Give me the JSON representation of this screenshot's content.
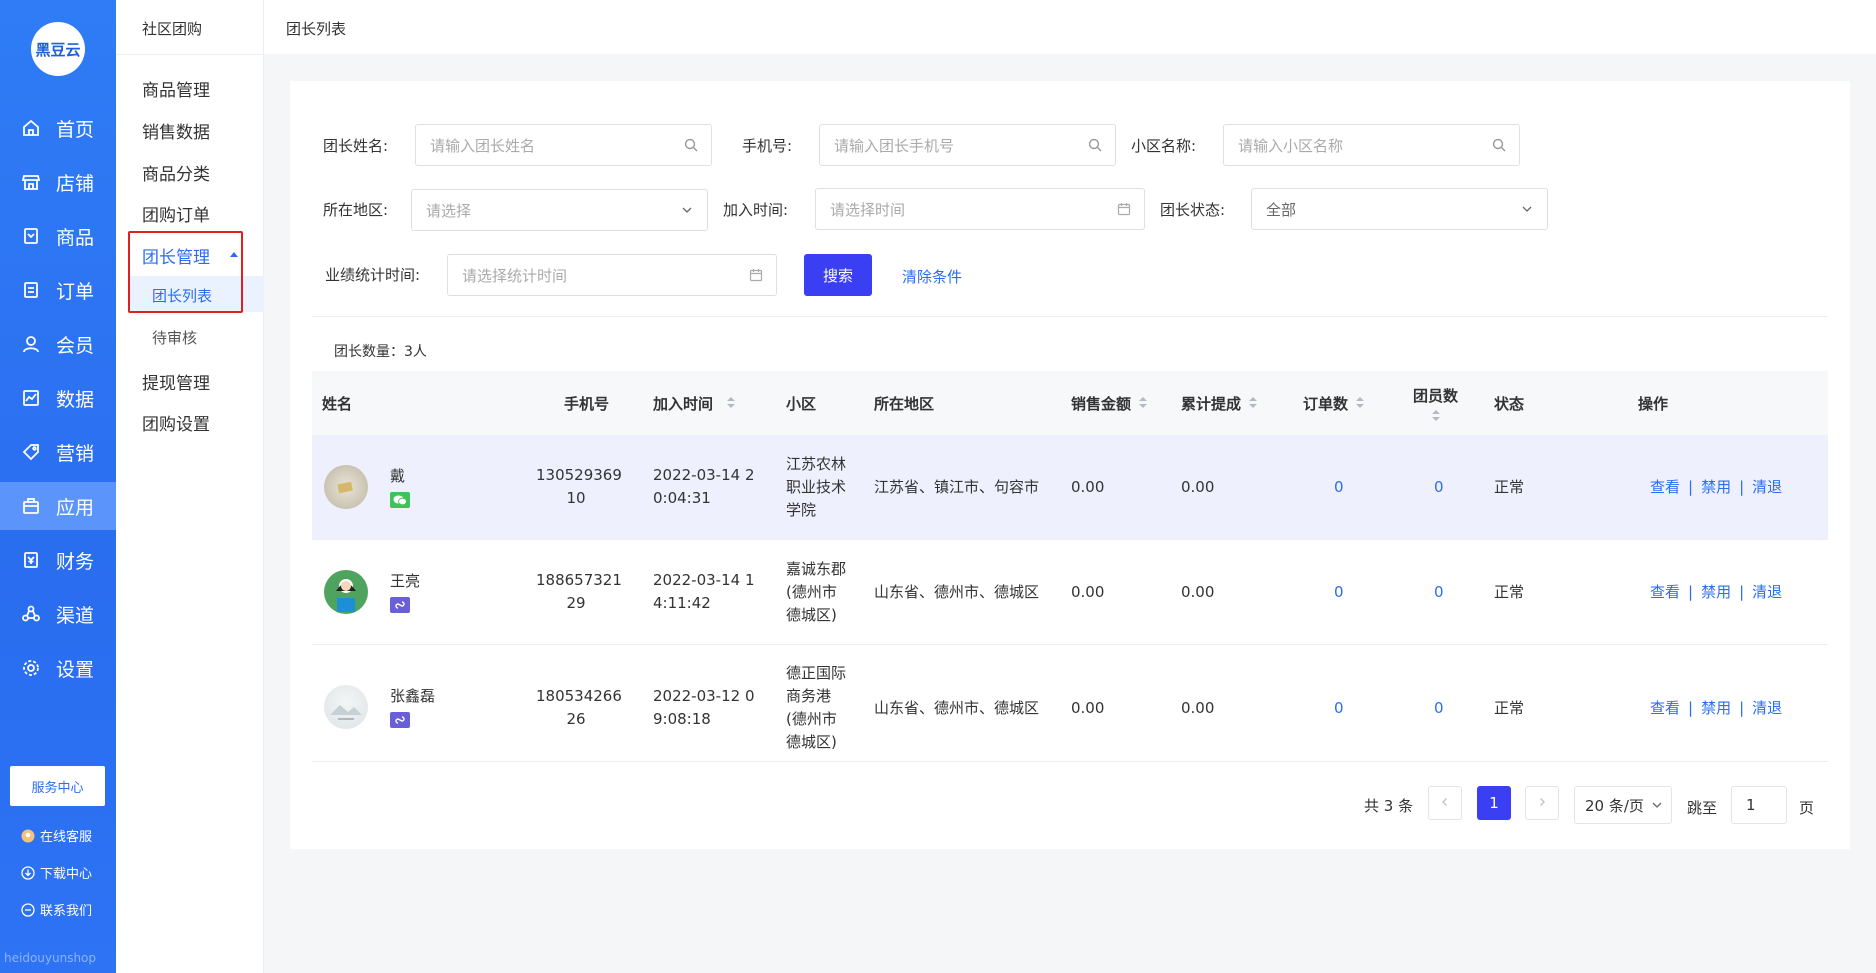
{
  "sidebar": {
    "logo_text": "黑豆云",
    "items": [
      {
        "label": "首页",
        "icon": "home-icon"
      },
      {
        "label": "店铺",
        "icon": "store-icon"
      },
      {
        "label": "商品",
        "icon": "product-icon"
      },
      {
        "label": "订单",
        "icon": "order-icon"
      },
      {
        "label": "会员",
        "icon": "member-icon"
      },
      {
        "label": "数据",
        "icon": "data-icon"
      },
      {
        "label": "营销",
        "icon": "tag-icon"
      },
      {
        "label": "应用",
        "icon": "app-icon"
      },
      {
        "label": "财务",
        "icon": "finance-icon"
      },
      {
        "label": "渠道",
        "icon": "channel-icon"
      },
      {
        "label": "设置",
        "icon": "gear-icon"
      }
    ],
    "active": "应用",
    "service_center": "服务中心",
    "links": [
      {
        "label": "在线客服",
        "icon": "chat-avatar-icon"
      },
      {
        "label": "下载中心",
        "icon": "download-icon"
      },
      {
        "label": "联系我们",
        "icon": "contact-icon"
      }
    ],
    "watermark": "heidouyunshop"
  },
  "subnav": {
    "title": "社区团购",
    "items": [
      "商品管理",
      "销售数据",
      "商品分类",
      "团购订单",
      "团长管理",
      "提现管理",
      "团购设置"
    ],
    "open_item": "团长管理",
    "children": [
      "团长列表",
      "待审核"
    ],
    "active_child": "团长列表"
  },
  "breadcrumb": "团长列表",
  "filters": {
    "name_label": "团长姓名:",
    "name_placeholder": "请输入团长姓名",
    "phone_label": "手机号:",
    "phone_placeholder": "请输入团长手机号",
    "community_label": "小区名称:",
    "community_placeholder": "请输入小区名称",
    "region_label": "所在地区:",
    "region_placeholder": "请选择",
    "join_label": "加入时间:",
    "join_placeholder": "请选择时间",
    "status_label": "团长状态:",
    "status_value": "全部",
    "perf_label": "业绩统计时间:",
    "perf_placeholder": "请选择统计时间",
    "search_label": "搜索",
    "clear_label": "清除条件"
  },
  "count_text": "团长数量：3人",
  "table": {
    "columns": [
      "姓名",
      "手机号",
      "加入时间",
      "小区",
      "所在地区",
      "销售金额",
      "累计提成",
      "订单数",
      "团员数",
      "状态",
      "操作"
    ],
    "rows": [
      {
        "name": "戴",
        "source": "wechat",
        "phone": [
          "130529369",
          "10"
        ],
        "join": [
          "2022-03-14 2",
          "0:04:31"
        ],
        "community": [
          "江苏农林",
          "职业技术",
          "学院"
        ],
        "region": "江苏省、镇江市、句容市",
        "sales": "0.00",
        "commission": "0.00",
        "orders": "0",
        "members": "0",
        "status": "正常"
      },
      {
        "name": "王亮",
        "source": "miniprogram",
        "phone": [
          "188657321",
          "29"
        ],
        "join": [
          "2022-03-14 1",
          "4:11:42"
        ],
        "community": [
          "嘉诚东郡",
          "(德州市",
          "德城区)"
        ],
        "region": "山东省、德州市、德城区",
        "sales": "0.00",
        "commission": "0.00",
        "orders": "0",
        "members": "0",
        "status": "正常"
      },
      {
        "name": "张鑫磊",
        "source": "miniprogram",
        "phone": [
          "180534266",
          "26"
        ],
        "join": [
          "2022-03-12 0",
          "9:08:18"
        ],
        "community": [
          "德正国际",
          "商务港",
          "(德州市",
          "德城区)"
        ],
        "region": "山东省、德州市、德城区",
        "sales": "0.00",
        "commission": "0.00",
        "orders": "0",
        "members": "0",
        "status": "正常"
      }
    ],
    "ops": [
      "查看",
      "禁用",
      "清退"
    ]
  },
  "pagination": {
    "total": "共 3 条",
    "current": "1",
    "page_size": "20 条/页",
    "jump_label": "跳至",
    "jump_value": "1",
    "page_label": "页"
  },
  "colors": {
    "primary": "#2a6df0",
    "button": "#3b3ff4",
    "highlight_row": "#eef0fd",
    "red_outline": "#e02020"
  }
}
